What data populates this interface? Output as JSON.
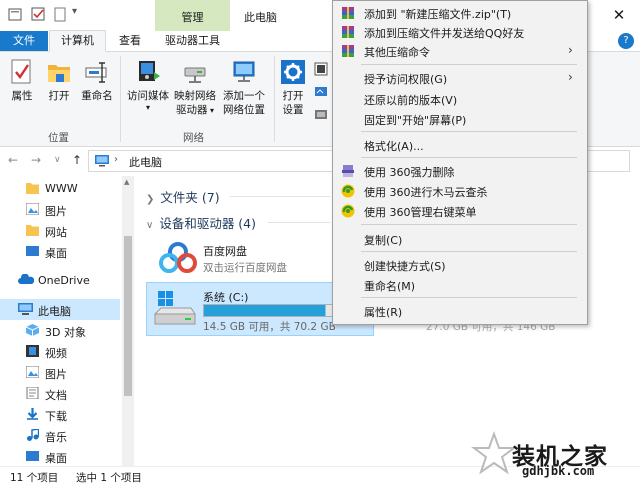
{
  "window": {
    "title": "此电脑",
    "context_tab": "管理",
    "close_glyph": "✕",
    "help_glyph": "?"
  },
  "ribbon_tabs": {
    "file": "文件",
    "computer": "计算机",
    "view": "查看",
    "drive_tools": "驱动器工具"
  },
  "ribbon": {
    "properties": "属性",
    "open": "打开",
    "rename": "重命名",
    "location_group": "位置",
    "access_media_line1": "访问媒体",
    "map_drive_line1": "映射网络",
    "map_drive_line2": "驱动器",
    "add_location_line1": "添加一个",
    "add_location_line2": "网络位置",
    "network_group": "网络",
    "open_settings_line1": "打开",
    "open_settings_line2": "设置"
  },
  "address": {
    "back": "←",
    "forward": "→",
    "recent": "∨",
    "up": "↑",
    "separator": "›",
    "path": "此电脑"
  },
  "nav_pane": {
    "items": [
      {
        "label": "WWW"
      },
      {
        "label": "图片"
      },
      {
        "label": "网站"
      },
      {
        "label": "桌面"
      },
      {
        "label": "OneDrive"
      },
      {
        "label": "此电脑"
      },
      {
        "label": "3D 对象"
      },
      {
        "label": "视频"
      },
      {
        "label": "图片"
      },
      {
        "label": "文档"
      },
      {
        "label": "下载"
      },
      {
        "label": "音乐"
      },
      {
        "label": "桌面"
      }
    ]
  },
  "content": {
    "folders_header": "文件夹 (7)",
    "devices_header": "设备和驱动器 (4)",
    "baidu_name": "百度网盘",
    "baidu_sub": "双击运行百度网盘",
    "drive_c_name": "系统 (C:)",
    "drive_c_free": "14.5 GB 可用，共 70.2 GB",
    "drive_c_used_fraction": 0.79,
    "drive2_free": "27.0 GB 可用，共 146 GB",
    "drive2_used_fraction": 0.82
  },
  "status": {
    "count": "11 个项目",
    "selected": "选中 1 个项目"
  },
  "context_menu": {
    "items": [
      {
        "label": "添加到 \"新建压缩文件.zip\"(T)",
        "icon": "archive-icon"
      },
      {
        "label": "添加到压缩文件并发送给QQ好友",
        "icon": "archive-icon"
      },
      {
        "label": "其他压缩命令",
        "icon": "archive-icon",
        "submenu": true
      },
      {
        "label": "授予访问权限(G)",
        "submenu": true
      },
      {
        "label": "还原以前的版本(V)"
      },
      {
        "label": "固定到\"开始\"屏幕(P)"
      },
      {
        "label": "格式化(A)..."
      },
      {
        "label": "使用 360强力删除",
        "icon": "shred-icon"
      },
      {
        "label": "使用 360进行木马云查杀",
        "icon": "shield-icon"
      },
      {
        "label": "使用 360管理右键菜单",
        "icon": "shield-icon"
      },
      {
        "label": "复制(C)"
      },
      {
        "label": "创建快捷方式(S)"
      },
      {
        "label": "重命名(M)"
      },
      {
        "label": "属性(R)"
      }
    ],
    "submenu_arrow": "›"
  },
  "watermark": {
    "text": "装机之家",
    "url": "gdhjbk.com"
  },
  "colors": {
    "accent": "#1979ca",
    "selection": "#cce8ff",
    "manage_tab": "#d5e8c0",
    "drive_bar": "#26a0da"
  }
}
